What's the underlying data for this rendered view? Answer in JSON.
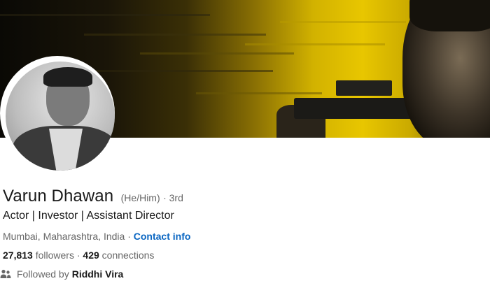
{
  "profile": {
    "name": "Varun Dhawan",
    "pronouns": "(He/Him)",
    "degree": "· 3rd",
    "headline": "Actor | Investor | Assistant Director",
    "location": "Mumbai, Maharashtra, India",
    "location_separator": "·",
    "contact_link": "Contact info",
    "followers_count": "27,813",
    "followers_label": "followers",
    "stats_separator": "·",
    "connections_count": "429",
    "connections_label": "connections",
    "followed_by_label": "Followed by",
    "followed_by_name": "Riddhi Vira"
  },
  "icons": {
    "people": "people-icon"
  },
  "colors": {
    "link": "#0a66c2",
    "cover_accent": "#e8c600"
  }
}
